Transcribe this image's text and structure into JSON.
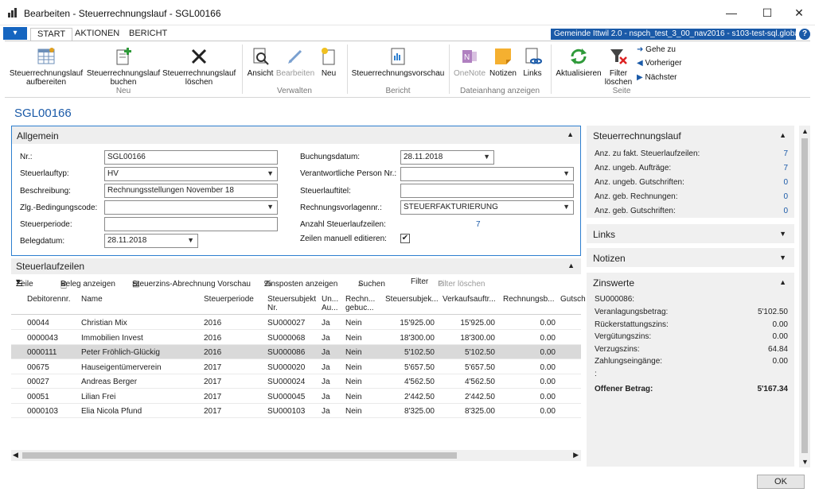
{
  "window": {
    "title": "Bearbeiten - Steuerrechnungslauf - SGL00166",
    "minimize": "—",
    "maximize": "☐",
    "close": "✕"
  },
  "tabs": {
    "app": "▾",
    "start": "START",
    "aktionen": "AKTIONEN",
    "bericht": "BERICHT"
  },
  "company": "Gemeinde Ittwil 2.0 - nspch_test_3_00_nav2016 - s103-test-sql.global...",
  "help": "?",
  "ribbon": {
    "aufbereiten": "Steuerrechnungslauf aufbereiten",
    "buchen": "Steuerrechnungslauf buchen",
    "loeschen": "Steuerrechnungslauf löschen",
    "grp_neu": "Neu",
    "ansicht": "Ansicht",
    "bearbeiten": "Bearbeiten",
    "neu": "Neu",
    "grp_verwalten": "Verwalten",
    "vorschau": "Steuerrechnungsvorschau",
    "grp_bericht": "Bericht",
    "onenote": "OneNote",
    "notizen": "Notizen",
    "links": "Links",
    "grp_datei": "Dateianhang anzeigen",
    "aktualisieren": "Aktualisieren",
    "filter_loeschen": "Filter löschen",
    "gehe_zu": "Gehe zu",
    "vorheriger": "Vorheriger",
    "naechster": "Nächster",
    "grp_seite": "Seite"
  },
  "page_title": "SGL00166",
  "allgemein": {
    "title": "Allgemein",
    "nr_label": "Nr.:",
    "nr": "SGL00166",
    "typ_label": "Steuerlauftyp:",
    "typ": "HV",
    "beschreibung_label": "Beschreibung:",
    "beschreibung": "Rechnungsstellungen November 18",
    "zlg_label": "Zlg.-Bedingungscode:",
    "zlg": "",
    "periode_label": "Steuerperiode:",
    "periode": "",
    "belegdatum_label": "Belegdatum:",
    "belegdatum": "28.11.2018",
    "buchungsdatum_label": "Buchungsdatum:",
    "buchungsdatum": "28.11.2018",
    "verantw_label": "Verantwortliche Person Nr.:",
    "verantw": "",
    "titel_label": "Steuerlauftitel:",
    "titel": "",
    "vorlage_label": "Rechnungsvorlagennr.:",
    "vorlage": "STEUERFAKTURIERUNG",
    "anzahl_label": "Anzahl Steuerlaufzeilen:",
    "anzahl": "7",
    "manuell_label": "Zeilen manuell editieren:",
    "manuell": "✔"
  },
  "lines": {
    "title": "Steuerlaufzeilen",
    "tb_zeile": "Zeile",
    "tb_beleg": "Beleg anzeigen",
    "tb_abrechnung": "Steuerzins-Abrechnung Vorschau",
    "tb_zinsposten": "Zinsposten anzeigen",
    "tb_suchen": "Suchen",
    "tb_filter": "Filter",
    "tb_filter_loeschen": "Filter löschen",
    "headers": [
      "Debitorennr.",
      "Name",
      "Steuerperiode",
      "Steuersubjekt Nr.",
      "Un... Au...",
      "Rechn... gebuc...",
      "Steuersubjek...",
      "Verkaufsauftr...",
      "Rechnungsb...",
      "Gutsch"
    ],
    "rows": [
      [
        "00044",
        "Christian Mix",
        "2016",
        "SU000027",
        "Ja",
        "Nein",
        "15'925.00",
        "15'925.00",
        "0.00"
      ],
      [
        "0000043",
        "Immobilien Invest",
        "2016",
        "SU000068",
        "Ja",
        "Nein",
        "18'300.00",
        "18'300.00",
        "0.00"
      ],
      [
        "0000111",
        "Peter Fröhlich-Glückig",
        "2016",
        "SU000086",
        "Ja",
        "Nein",
        "5'102.50",
        "5'102.50",
        "0.00"
      ],
      [
        "00675",
        "Hauseigentümerverein",
        "2017",
        "SU000020",
        "Ja",
        "Nein",
        "5'657.50",
        "5'657.50",
        "0.00"
      ],
      [
        "00027",
        "Andreas Berger",
        "2017",
        "SU000024",
        "Ja",
        "Nein",
        "4'562.50",
        "4'562.50",
        "0.00"
      ],
      [
        "00051",
        "Lilian Frei",
        "2017",
        "SU000045",
        "Ja",
        "Nein",
        "2'442.50",
        "2'442.50",
        "0.00"
      ],
      [
        "0000103",
        "Elia Nicola Pfund",
        "2017",
        "SU000103",
        "Ja",
        "Nein",
        "8'325.00",
        "8'325.00",
        "0.00"
      ]
    ]
  },
  "factbox": {
    "lauf_title": "Steuerrechnungslauf",
    "lauf": [
      {
        "k": "Anz. zu fakt. Steuerlaufzeilen:",
        "v": "7"
      },
      {
        "k": "Anz. ungeb. Aufträge:",
        "v": "7"
      },
      {
        "k": "Anz. ungeb. Gutschriften:",
        "v": "0"
      },
      {
        "k": "Anz. geb. Rechnungen:",
        "v": "0"
      },
      {
        "k": "Anz. geb. Gutschriften:",
        "v": "0"
      }
    ],
    "links_title": "Links",
    "notizen_title": "Notizen",
    "zins_title": "Zinswerte",
    "zins_id": "SU000086:",
    "zins": [
      {
        "k": "Veranlagungsbetrag:",
        "v": "5'102.50"
      },
      {
        "k": "Rückerstattungszins:",
        "v": "0.00"
      },
      {
        "k": "Vergütungszins:",
        "v": "0.00"
      },
      {
        "k": "Verzugszins:",
        "v": "64.84"
      },
      {
        "k": "Zahlungseingänge:",
        "v": "0.00"
      },
      {
        "k": ":",
        "v": ""
      },
      {
        "k": "Offener Betrag:",
        "v": "5'167.34"
      }
    ]
  },
  "ok": "OK"
}
